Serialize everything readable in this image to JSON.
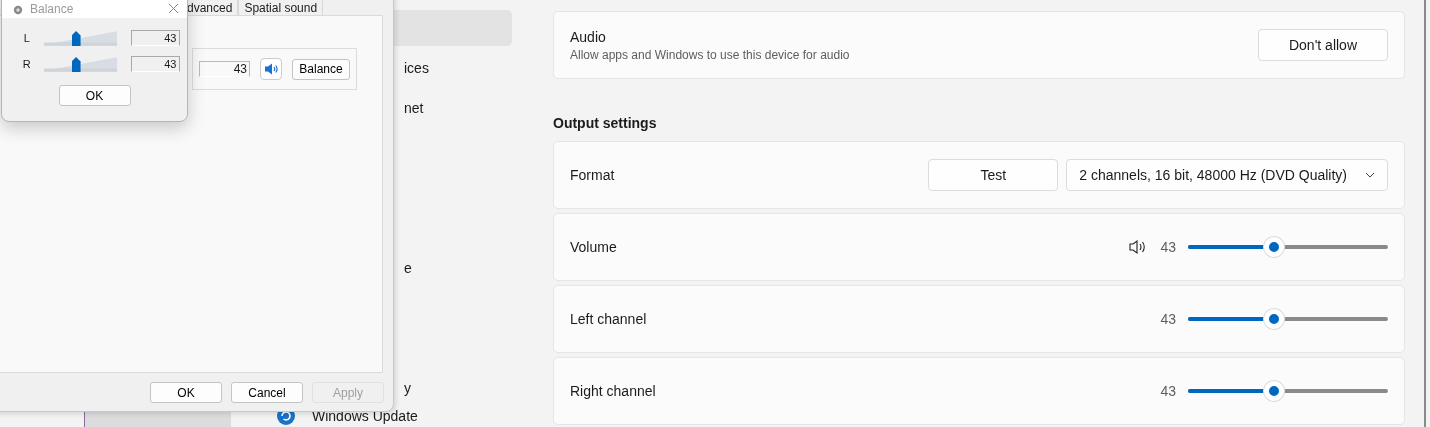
{
  "settings_nav": {
    "items": [
      {
        "selected": true
      },
      {
        "label": "ices",
        "selected": false
      },
      {
        "label": "net",
        "selected": false
      },
      {
        "label": "e",
        "selected": false
      },
      {
        "label": "y",
        "selected": false
      },
      {
        "label": "Windows Update",
        "selected": false
      }
    ]
  },
  "audio_card": {
    "title": "Audio",
    "description": "Allow apps and Windows to use this device for audio",
    "button": "Don't allow"
  },
  "output_settings": {
    "heading": "Output settings",
    "rows": [
      {
        "kind": "format",
        "label": "Format",
        "button": "Test",
        "dropdown": "2 channels, 16 bit, 48000 Hz (DVD Quality)"
      },
      {
        "kind": "slider",
        "label": "Volume",
        "icon": true,
        "reading": "43",
        "level": 0.43
      },
      {
        "kind": "slider",
        "label": "Left channel",
        "icon": false,
        "reading": "43",
        "level": 0.43
      },
      {
        "kind": "slider",
        "label": "Right channel",
        "icon": false,
        "reading": "43",
        "level": 0.43
      }
    ]
  },
  "sound_dialog": {
    "tabs": [
      {
        "label": "dvanced",
        "selected": false
      },
      {
        "label": "Spatial sound",
        "selected": false
      }
    ],
    "level_field": "43",
    "balance_button": "Balance",
    "buttons": [
      {
        "label": "OK",
        "disabled": false
      },
      {
        "label": "Cancel",
        "disabled": false
      },
      {
        "label": "Apply",
        "disabled": true
      }
    ]
  },
  "balance_dialog": {
    "title": "Balance",
    "channels": [
      {
        "name": "L",
        "level": 0.43,
        "value": "43"
      },
      {
        "name": "R",
        "level": 0.43,
        "value": "43"
      }
    ],
    "button": "OK"
  }
}
